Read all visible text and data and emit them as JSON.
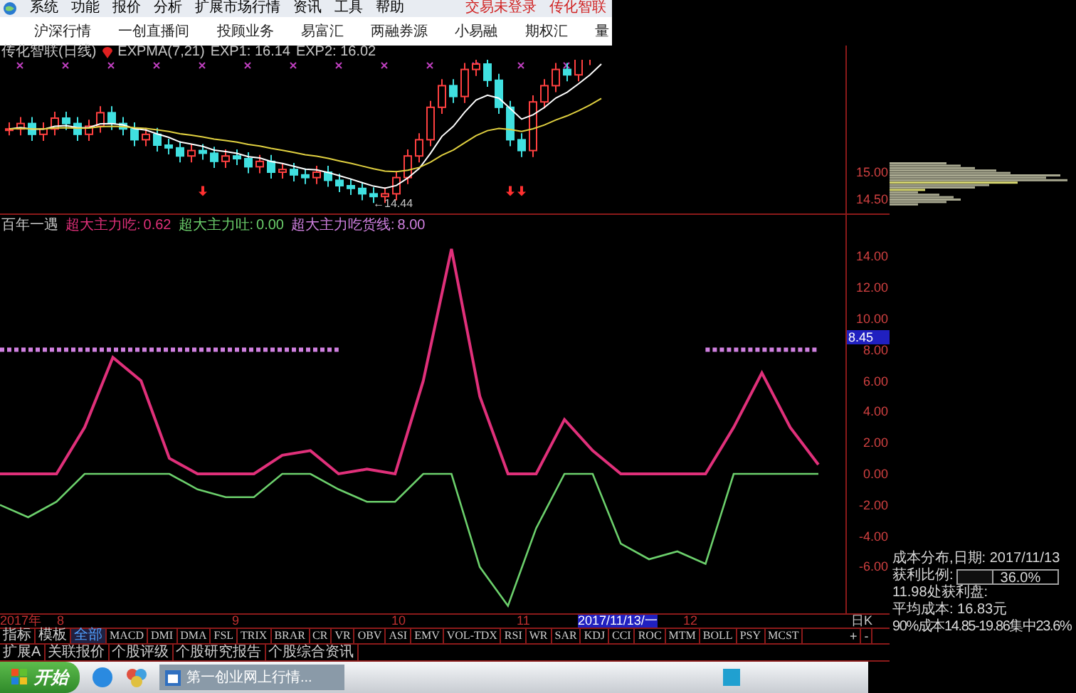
{
  "menu_bar": {
    "items": [
      "系统",
      "功能",
      "报价",
      "分析",
      "扩展市场行情",
      "资讯",
      "工具",
      "帮助"
    ],
    "status": "交易未登录",
    "account": "传化智联"
  },
  "tabs": [
    {
      "label": "沪深行情"
    },
    {
      "label": "一创直播间"
    },
    {
      "label": "投顾业务"
    },
    {
      "label": "易富汇"
    },
    {
      "label": "两融券源"
    },
    {
      "label": "小易融"
    },
    {
      "label": "期权汇"
    },
    {
      "label": "量"
    }
  ],
  "price_chart": {
    "title": "传化智联(日线)",
    "indicator": "EXPMA(7,21)",
    "exp1": "EXP1: 16.14",
    "exp2": "EXP2: 16.02",
    "low_label": "←14.44",
    "axis_labels": [
      "15.00",
      "14.50"
    ]
  },
  "indicator_chart": {
    "name": "百年一遇",
    "legend_values": [
      "0.62",
      "0.00",
      "8.00"
    ],
    "current_value": "8.45",
    "chart_data": {
      "type": "line",
      "ylim": [
        -9.08,
        15.41
      ],
      "yticks": [
        {
          "value": 14,
          "label": "14.00"
        },
        {
          "value": 12,
          "label": "12.00"
        },
        {
          "value": 10,
          "label": "10.00"
        },
        {
          "value": 8,
          "label": "8.00"
        },
        {
          "value": 6,
          "label": "6.00"
        },
        {
          "value": 4,
          "label": "4.00"
        },
        {
          "value": 2,
          "label": "2.00"
        },
        {
          "value": 0,
          "label": "0.00"
        },
        {
          "value": -2,
          "label": "-2.00"
        },
        {
          "value": -4,
          "label": "-4.00"
        },
        {
          "value": -6,
          "label": "-6.00"
        }
      ],
      "series": [
        {
          "name": "超大主力吃:",
          "color": "#e0307a",
          "values": [
            0,
            0,
            0,
            3,
            7.5,
            6,
            1,
            0,
            0,
            0,
            1.2,
            1.5,
            0,
            0.3,
            0,
            6,
            14.5,
            5,
            0,
            0,
            3.5,
            1.5,
            0,
            0,
            0,
            0,
            3,
            6.5,
            3,
            0.6
          ]
        },
        {
          "name": "超大主力吐:",
          "color": "#6cd06c",
          "values": [
            -2,
            -2.8,
            -1.8,
            0,
            0,
            0,
            0,
            -1,
            -1.5,
            -1.5,
            0,
            0,
            -1,
            -1.8,
            -1.8,
            0,
            0,
            -6,
            -8.5,
            -3.5,
            0,
            0,
            -4.5,
            -5.5,
            -5,
            -5.8,
            0,
            0,
            0,
            0
          ]
        },
        {
          "name": "超大主力吃货线:",
          "line_style": "dotted",
          "color": "#d080e0",
          "values": [
            8,
            8,
            8,
            8,
            8,
            8,
            8,
            8,
            8,
            8,
            8,
            8,
            8,
            null,
            null,
            null,
            null,
            null,
            null,
            null,
            null,
            null,
            null,
            null,
            null,
            8,
            8,
            8,
            8,
            8
          ]
        }
      ]
    }
  },
  "date_axis": [
    {
      "label": "2017年",
      "selected": false
    },
    {
      "label": "8",
      "selected": false
    },
    {
      "label": "9",
      "selected": false
    },
    {
      "label": "10",
      "selected": false
    },
    {
      "label": "11",
      "selected": false
    },
    {
      "label": "2017/11/13/一",
      "selected": true
    },
    {
      "label": "12",
      "selected": false
    }
  ],
  "period": "日K",
  "indicator_tabs": [
    {
      "label": "指标",
      "selected": false
    },
    {
      "label": "模板",
      "selected": false
    },
    {
      "label": "全部",
      "selected": true
    },
    {
      "label": "MACD",
      "selected": false
    },
    {
      "label": "DMI",
      "selected": false
    },
    {
      "label": "DMA",
      "selected": false
    },
    {
      "label": "FSL",
      "selected": false
    },
    {
      "label": "TRIX",
      "selected": false
    },
    {
      "label": "BRAR",
      "selected": false
    },
    {
      "label": "CR",
      "selected": false
    },
    {
      "label": "VR",
      "selected": false
    },
    {
      "label": "OBV",
      "selected": false
    },
    {
      "label": "ASI",
      "selected": false
    },
    {
      "label": "EMV",
      "selected": false
    },
    {
      "label": "VOL-TDX",
      "selected": false
    },
    {
      "label": "RSI",
      "selected": false
    },
    {
      "label": "WR",
      "selected": false
    },
    {
      "label": "SAR",
      "selected": false
    },
    {
      "label": "KDJ",
      "selected": false
    },
    {
      "label": "CCI",
      "selected": false
    },
    {
      "label": "ROC",
      "selected": false
    },
    {
      "label": "MTM",
      "selected": false
    },
    {
      "label": "BOLL",
      "selected": false
    },
    {
      "label": "PSY",
      "selected": false
    },
    {
      "label": "MCST",
      "selected": false
    }
  ],
  "zoom_buttons": [
    "+",
    "-"
  ],
  "info_tabs": [
    "扩展A",
    "关联报价",
    "个股评级",
    "个股研究报告",
    "个股综合资讯"
  ],
  "cost_panel": {
    "title": "成本分布,日期: 2017/11/13",
    "profit_label": "获利比例:",
    "profit_ratio": {
      "level": 0.36,
      "reading": "36.0%"
    },
    "profit_at": "11.98处获利盘:",
    "avg_cost": "平均成本: 16.83元",
    "concentration": "90%成本14.85-19.86集中23.6%"
  },
  "taskbar": {
    "start": "开始",
    "windows": [
      {
        "label": "第一创业网上行情..."
      }
    ]
  }
}
